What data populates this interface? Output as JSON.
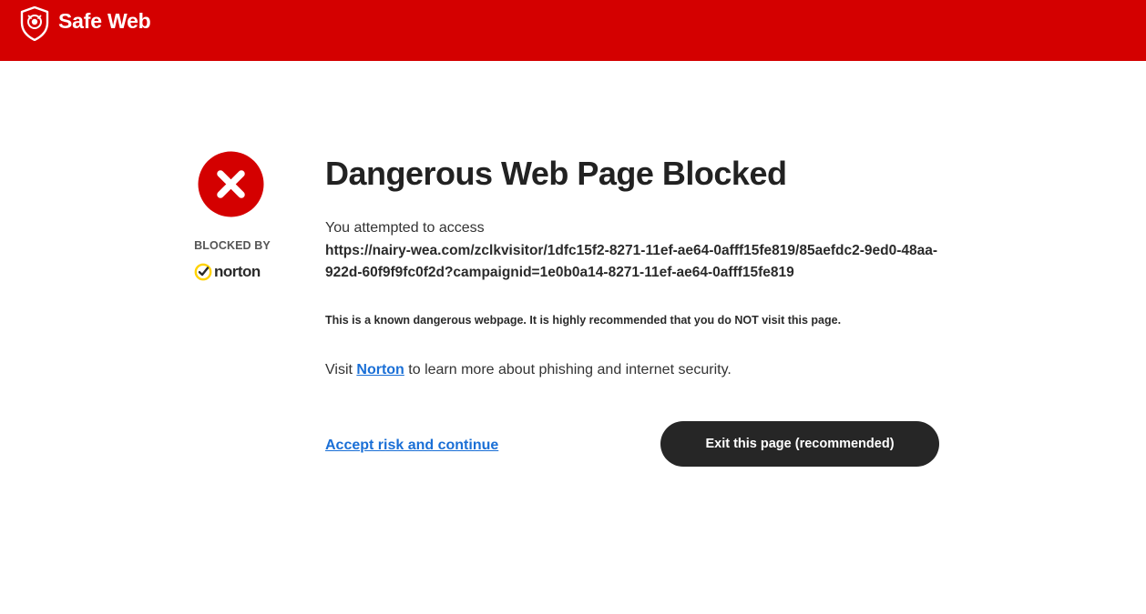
{
  "header": {
    "title": "Safe Web",
    "icon": "shield-icon",
    "background_color": "#d40000"
  },
  "sidebar": {
    "status_icon": "blocked-x-icon",
    "status_color": "#d40000",
    "blocked_by_label": "BLOCKED BY",
    "vendor_logo_text": "norton",
    "vendor_logo_icon": "norton-check-icon",
    "vendor_accent_color": "#ffd200"
  },
  "main": {
    "title": "Dangerous Web Page Blocked",
    "attempt_label": "You attempted to access",
    "blocked_url": "https://nairy-wea.com/zclkvisitor/1dfc15f2-8271-11ef-ae64-0afff15fe819/85aefdc2-9ed0-48aa-922d-60f9f9fc0f2d?campaignid=1e0b0a14-8271-11ef-ae64-0afff15fe819",
    "warning": "This is a known dangerous webpage. It is highly recommended that you do NOT visit this page.",
    "learn_more_prefix": "Visit ",
    "learn_more_link": "Norton",
    "learn_more_suffix": " to learn more about phishing and internet security.",
    "link_color": "#1a6fd6"
  },
  "actions": {
    "accept_label": "Accept risk and continue",
    "exit_label": "Exit this page (recommended)"
  }
}
